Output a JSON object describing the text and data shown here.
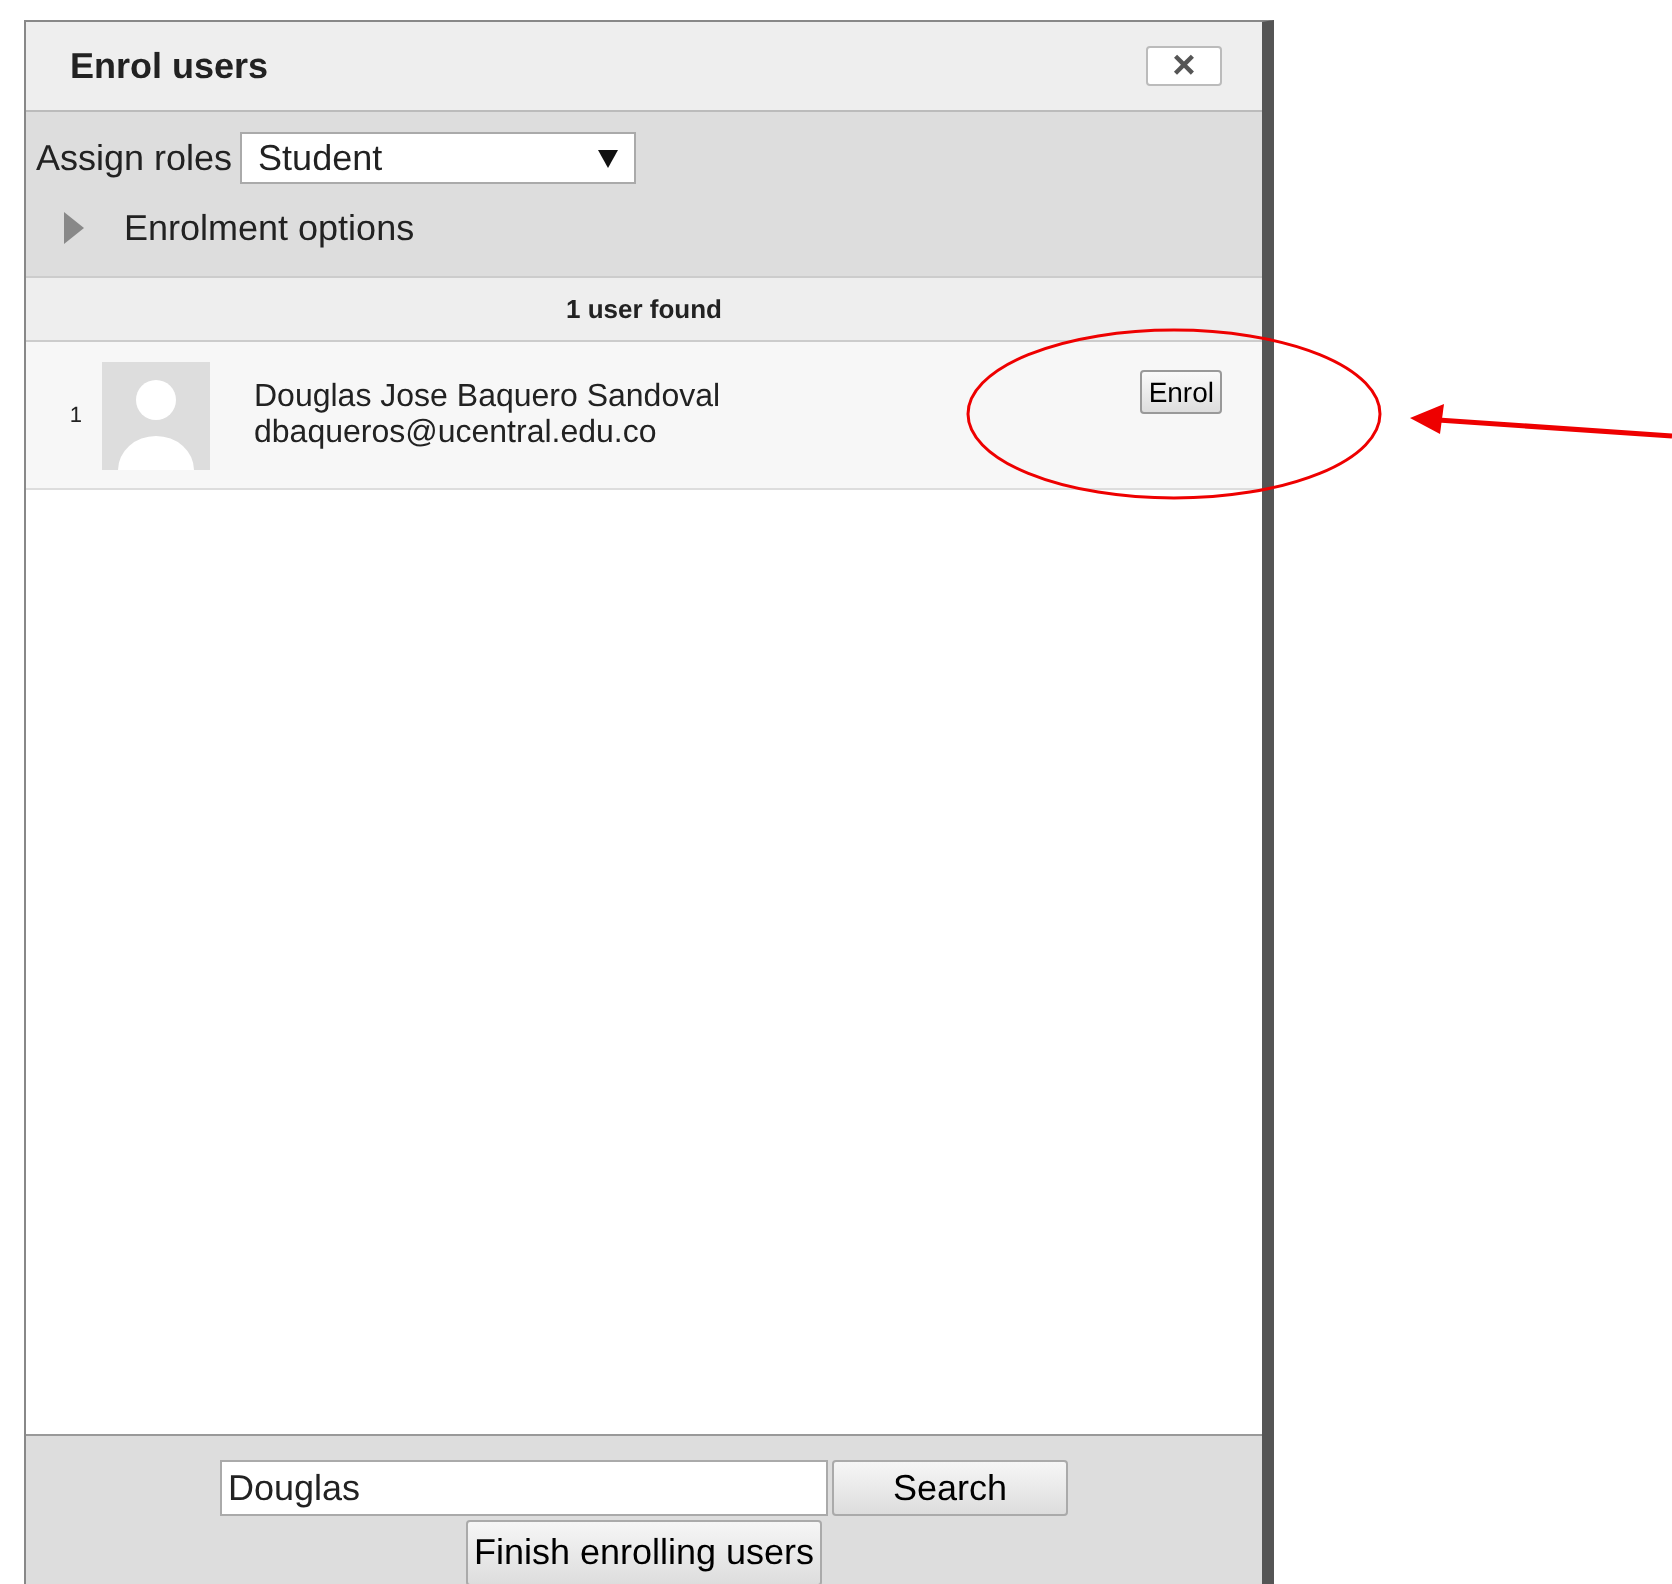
{
  "dialog": {
    "title": "Enrol users",
    "close": "×"
  },
  "roles": {
    "label": "Assign roles",
    "value": "Student"
  },
  "options": {
    "label": "Enrolment options",
    "expanded": false
  },
  "results": {
    "heading": "1 user found",
    "users": [
      {
        "index": "1",
        "name": "Douglas Jose Baquero Sandoval",
        "email": "dbaqueros@ucentral.edu.co",
        "action": "Enrol"
      }
    ]
  },
  "search": {
    "value": "Douglas",
    "button": "Search"
  },
  "finish": "Finish enrolling users"
}
